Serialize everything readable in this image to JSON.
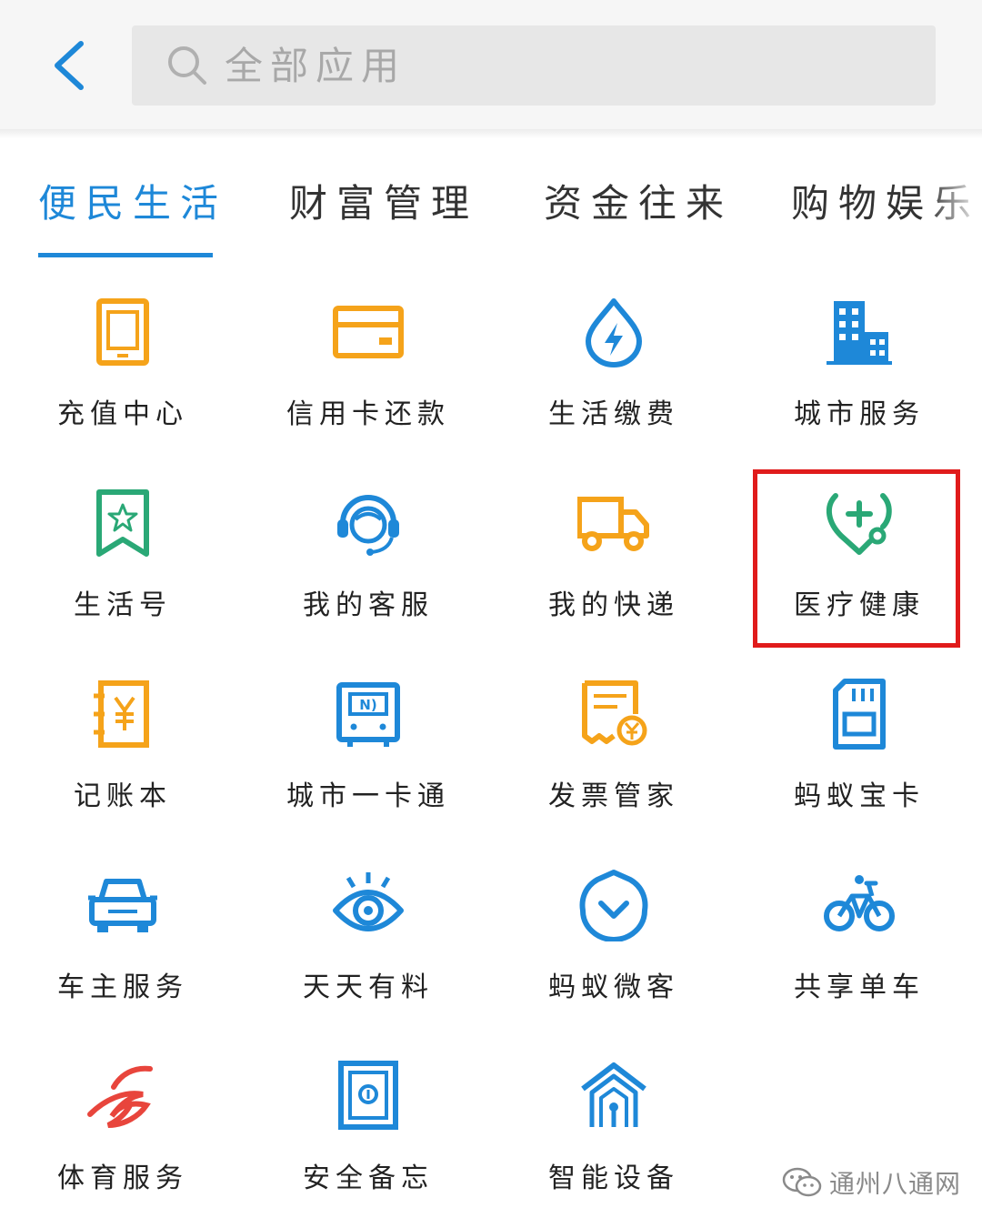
{
  "search": {
    "placeholder": "全部应用"
  },
  "tabs": [
    {
      "label": "便民生活",
      "active": true
    },
    {
      "label": "财富管理",
      "active": false
    },
    {
      "label": "资金往来",
      "active": false
    },
    {
      "label": "购物娱乐",
      "active": false
    }
  ],
  "apps": [
    {
      "label": "充值中心",
      "icon": "tablet-recharge-icon"
    },
    {
      "label": "信用卡还款",
      "icon": "credit-card-icon"
    },
    {
      "label": "生活缴费",
      "icon": "water-drop-lightning-icon"
    },
    {
      "label": "城市服务",
      "icon": "city-buildings-icon"
    },
    {
      "label": "生活号",
      "icon": "bookmark-star-icon"
    },
    {
      "label": "我的客服",
      "icon": "headset-agent-icon"
    },
    {
      "label": "我的快递",
      "icon": "delivery-truck-icon"
    },
    {
      "label": "医疗健康",
      "icon": "stethoscope-plus-icon"
    },
    {
      "label": "记账本",
      "icon": "yuan-ledger-icon"
    },
    {
      "label": "城市一卡通",
      "icon": "nfc-transit-card-icon"
    },
    {
      "label": "发票管家",
      "icon": "invoice-yuan-icon"
    },
    {
      "label": "蚂蚁宝卡",
      "icon": "sim-card-icon"
    },
    {
      "label": "车主服务",
      "icon": "car-icon"
    },
    {
      "label": "天天有料",
      "icon": "eye-watch-icon"
    },
    {
      "label": "蚂蚁微客",
      "icon": "shield-chevron-icon"
    },
    {
      "label": "共享单车",
      "icon": "bicycle-icon"
    },
    {
      "label": "体育服务",
      "icon": "sports-logo-icon"
    },
    {
      "label": "安全备忘",
      "icon": "safe-box-icon"
    },
    {
      "label": "智能设备",
      "icon": "smart-home-icon"
    }
  ],
  "watermark": {
    "text": "通州八通网",
    "icon": "wechat-icon"
  },
  "colors": {
    "accent_blue": "#1e88d8",
    "orange": "#f5a31a",
    "green": "#2aa876",
    "red_highlight": "#e01b1b",
    "sports_red": "#e8453c"
  }
}
